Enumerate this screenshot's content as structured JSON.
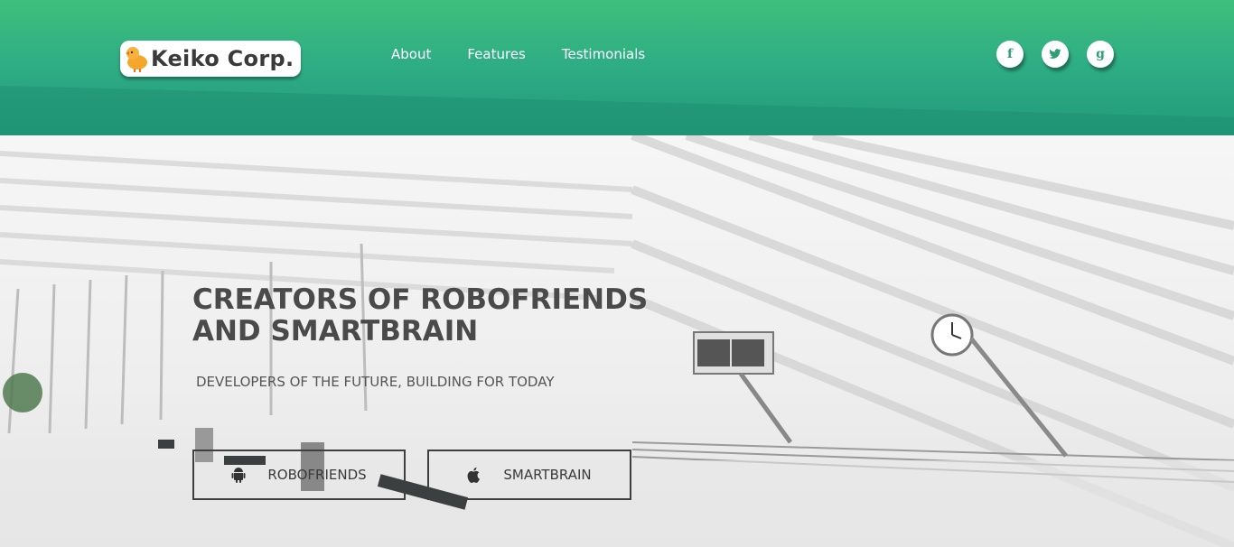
{
  "header": {
    "logo_text": "Keiko Corp.",
    "nav": [
      {
        "label": "About"
      },
      {
        "label": "Features"
      },
      {
        "label": "Testimonials"
      }
    ],
    "social": [
      {
        "name": "facebook-icon",
        "glyph": "f"
      },
      {
        "name": "twitter-icon",
        "glyph": "t"
      },
      {
        "name": "google-icon",
        "glyph": "g"
      }
    ]
  },
  "hero": {
    "title": "CREATORS OF ROBOFRIENDS AND SMARTBRAIN",
    "subtitle": "DEVELOPERS OF THE FUTURE, BUILDING FOR TODAY",
    "buttons": [
      {
        "label": "ROBOFRIENDS",
        "icon": "android-icon"
      },
      {
        "label": "SMARTBRAIN",
        "icon": "apple-icon"
      }
    ]
  },
  "colors": {
    "header_top": "#3fbf7c",
    "header_bottom": "#229a7a",
    "text_dark": "#4a4a4a"
  }
}
